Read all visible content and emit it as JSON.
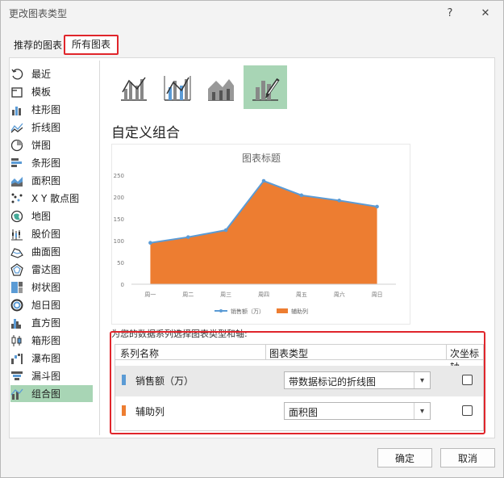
{
  "window": {
    "title": "更改图表类型",
    "help": "?",
    "close": "✕"
  },
  "tabs": [
    {
      "label": "推荐的图表"
    },
    {
      "label": "所有图表"
    }
  ],
  "sidebar": {
    "items": [
      {
        "label": "最近",
        "icon": "recent-icon"
      },
      {
        "label": "模板",
        "icon": "template-icon"
      },
      {
        "label": "柱形图",
        "icon": "column-chart-icon"
      },
      {
        "label": "折线图",
        "icon": "line-chart-icon"
      },
      {
        "label": "饼图",
        "icon": "pie-chart-icon"
      },
      {
        "label": "条形图",
        "icon": "bar-chart-icon"
      },
      {
        "label": "面积图",
        "icon": "area-chart-icon"
      },
      {
        "label": "X Y 散点图",
        "icon": "scatter-chart-icon"
      },
      {
        "label": "地图",
        "icon": "map-chart-icon"
      },
      {
        "label": "股价图",
        "icon": "stock-chart-icon"
      },
      {
        "label": "曲面图",
        "icon": "surface-chart-icon"
      },
      {
        "label": "雷达图",
        "icon": "radar-chart-icon"
      },
      {
        "label": "树状图",
        "icon": "treemap-chart-icon"
      },
      {
        "label": "旭日图",
        "icon": "sunburst-chart-icon"
      },
      {
        "label": "直方图",
        "icon": "histogram-chart-icon"
      },
      {
        "label": "箱形图",
        "icon": "box-whisker-chart-icon"
      },
      {
        "label": "瀑布图",
        "icon": "waterfall-chart-icon"
      },
      {
        "label": "漏斗图",
        "icon": "funnel-chart-icon"
      },
      {
        "label": "组合图",
        "icon": "combo-chart-icon"
      }
    ],
    "selected": "组合图"
  },
  "heading": "自定义组合",
  "chart_data": {
    "type": "area",
    "title": "图表标题",
    "categories": [
      "周一",
      "周二",
      "周三",
      "周四",
      "周五",
      "周六",
      "周日"
    ],
    "series": [
      {
        "name": "销售额（万）",
        "kind": "line",
        "color": "#5b9bd5",
        "values": [
          95,
          108,
          124,
          237,
          204,
          192,
          178
        ]
      },
      {
        "name": "辅助列",
        "kind": "area",
        "color": "#ed7d31",
        "values": [
          95,
          108,
          124,
          237,
          204,
          192,
          178
        ]
      }
    ],
    "yticks": [
      0,
      50,
      100,
      150,
      200,
      250
    ],
    "ylim": [
      0,
      250
    ],
    "legend": "bottom",
    "grid": false
  },
  "instruction": "为您的数据系列选择图表类型和轴:",
  "series_table": {
    "headers": [
      "系列名称",
      "图表类型",
      "次坐标轴"
    ],
    "rows": [
      {
        "name": "销售额（万）",
        "chart_type": "带数据标记的折线图",
        "color": "#5b9bd5",
        "secondary": false
      },
      {
        "name": "辅助列",
        "chart_type": "面积图",
        "color": "#ed7d31",
        "secondary": false
      }
    ]
  },
  "buttons": {
    "ok": "确定",
    "cancel": "取消"
  },
  "colors": {
    "accent_green": "#a8d5b5",
    "highlight_red": "#e0252b"
  }
}
